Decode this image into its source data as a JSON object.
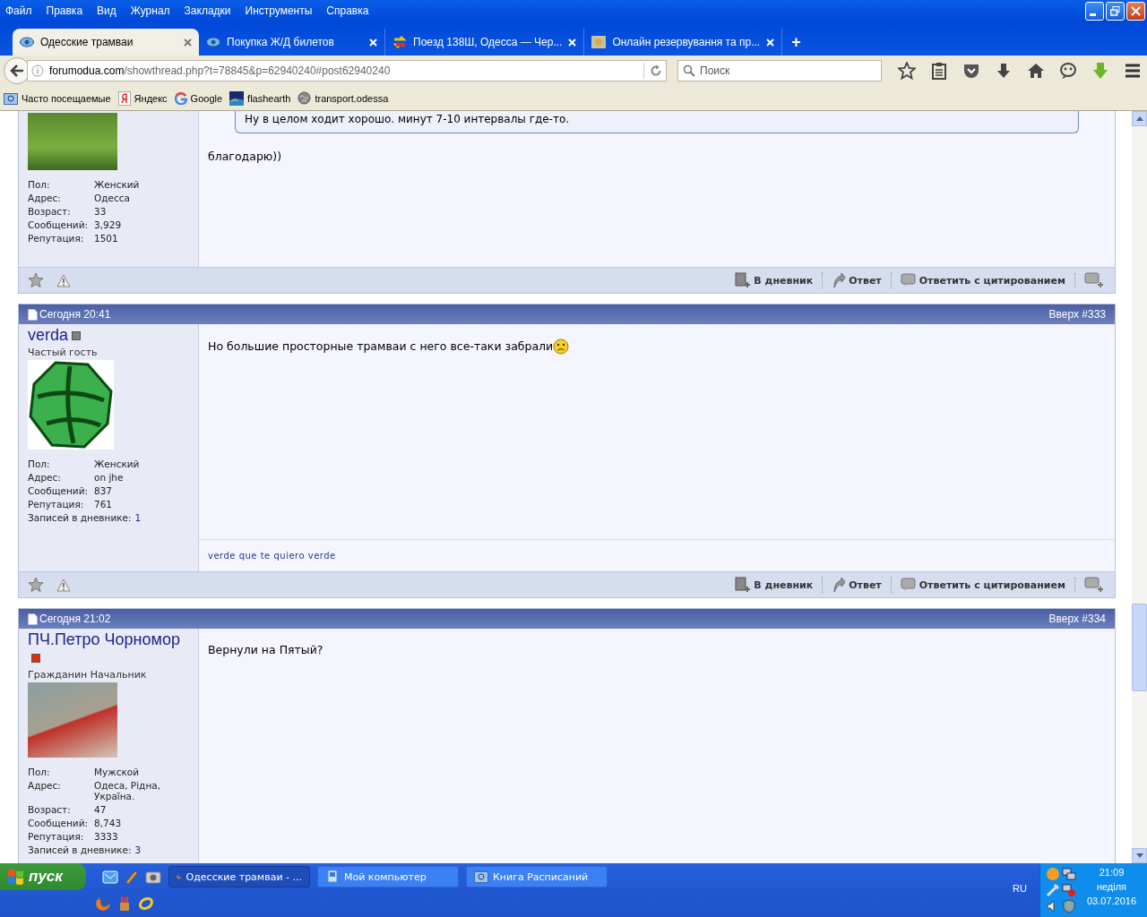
{
  "menu": [
    "Файл",
    "Правка",
    "Вид",
    "Журнал",
    "Закладки",
    "Инструменты",
    "Справка"
  ],
  "tabs": [
    {
      "title": "Одесские трамваи",
      "selected": true,
      "kind": "forum"
    },
    {
      "title": "Покупка Ж/Д билетов",
      "selected": false,
      "kind": "forum"
    },
    {
      "title": "Поезд 138Ш, Одесса — Чер...",
      "selected": false,
      "kind": "arrows"
    },
    {
      "title": "Онлайн резервування та пр...",
      "selected": false,
      "kind": "thumb"
    }
  ],
  "new_tab": "+",
  "address": {
    "domain": "forumodua.com",
    "path": "/showthread.php?t=78845&p=62940240#post62940240"
  },
  "search": {
    "placeholder": "Поиск"
  },
  "bookmarks": [
    {
      "label": "Часто посещаемые",
      "kind": "folder"
    },
    {
      "label": "Яндекс",
      "kind": "letter"
    },
    {
      "label": "Google",
      "kind": "g"
    },
    {
      "label": "flashearth",
      "kind": "photo"
    },
    {
      "label": "transport.odessa",
      "kind": "globe"
    }
  ],
  "posts": [
    {
      "partial": true,
      "avatar": {
        "kind": "photo"
      },
      "stats": [
        {
          "label": "Пол:",
          "value": "Женский",
          "link": false
        },
        {
          "label": "Адрес:",
          "value": "Одесса",
          "link": false
        },
        {
          "label": "Возраст:",
          "value": "33",
          "link": false
        },
        {
          "label": "Сообщений:",
          "value": "3,929",
          "link": false
        },
        {
          "label": "Репутация:",
          "value": "1501",
          "link": false
        }
      ],
      "quote": "Ну в целом ходит хорошо. минут 7-10 интервалы где-то.",
      "message": "благодарю))",
      "smiley": false,
      "actions": [
        "В дневник",
        "Ответ",
        "Ответить с цитированием"
      ]
    },
    {
      "partial": false,
      "date": "Сегодня 20:41",
      "number": "Вверх #333",
      "user": {
        "name": "verda",
        "color": "#808080",
        "title": "Частый гость"
      },
      "avatar": {
        "kind": "drawing"
      },
      "stats": [
        {
          "label": "Пол:",
          "value": "Женский",
          "link": false
        },
        {
          "label": "Адрес:",
          "value": "on jhe",
          "link": false
        },
        {
          "label": "Сообщений:",
          "value": "837",
          "link": false
        },
        {
          "label": "Репутация:",
          "value": "761",
          "link": false
        },
        {
          "label": "Записей в дневнике:",
          "value": "1",
          "link": true
        }
      ],
      "message": "Но большие просторные трамваи с него все-таки забрали",
      "smiley": true,
      "signature": "verde que te quiero verde",
      "actions": [
        "В дневник",
        "Ответ",
        "Ответить с цитированием"
      ]
    },
    {
      "partial": false,
      "date": "Сегодня 21:02",
      "number": "Вверх #334",
      "user": {
        "name": "ПЧ.Петро Чорномор",
        "color": "#e03010",
        "title": "Гражданин Начальник"
      },
      "avatar": {
        "kind": "photo"
      },
      "stats": [
        {
          "label": "Пол:",
          "value": "Мужской",
          "link": false
        },
        {
          "label": "Адрес:",
          "value": "Одеса, Рідна, Україна.",
          "link": false
        },
        {
          "label": "Возраст:",
          "value": "47",
          "link": false
        },
        {
          "label": "Сообщений:",
          "value": "8,743",
          "link": false
        },
        {
          "label": "Репутация:",
          "value": "3333",
          "link": false
        },
        {
          "label": "Записей в дневнике:",
          "value": "3",
          "link": true
        }
      ],
      "message": "Вернули на Пятый?",
      "smiley": false
    }
  ],
  "taskbar": {
    "start": "пуск",
    "tasks": [
      {
        "label": "Одесские трамваи - ...",
        "selected": true,
        "kind": "browser"
      },
      {
        "label": "Мой компьютер",
        "selected": false,
        "kind": "computer"
      },
      {
        "label": "Книга Расписаний",
        "selected": false,
        "kind": "folder"
      }
    ],
    "language": "RU",
    "time": "21:09",
    "day": "неділя",
    "date": "03.07.2016"
  }
}
